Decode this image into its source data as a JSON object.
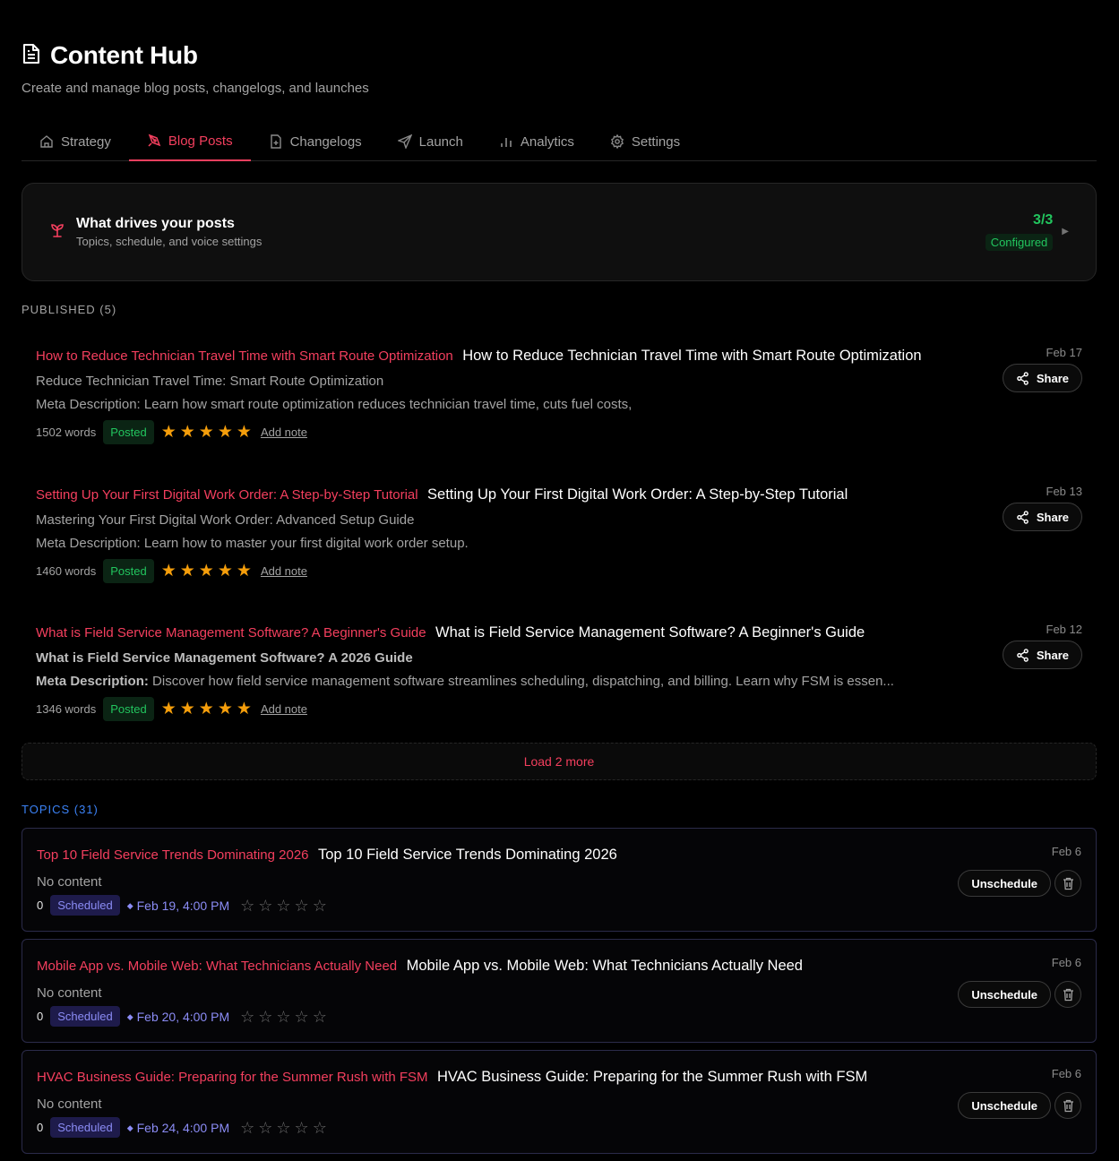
{
  "header": {
    "title": "Content Hub",
    "subtitle": "Create and manage blog posts, changelogs, and launches"
  },
  "tabs": [
    {
      "label": "Strategy",
      "icon": "home-icon",
      "active": false
    },
    {
      "label": "Blog Posts",
      "icon": "pen-icon",
      "active": true
    },
    {
      "label": "Changelogs",
      "icon": "file-plus-icon",
      "active": false
    },
    {
      "label": "Launch",
      "icon": "send-icon",
      "active": false
    },
    {
      "label": "Analytics",
      "icon": "bar-chart-icon",
      "active": false
    },
    {
      "label": "Settings",
      "icon": "gear-icon",
      "active": false
    }
  ],
  "drives": {
    "title": "What drives your posts",
    "subtitle": "Topics, schedule, and voice settings",
    "count": "3/3",
    "status": "Configured"
  },
  "published": {
    "label": "PUBLISHED (5)",
    "posts": [
      {
        "title_pink": "How to Reduce Technician Travel Time with Smart Route Optimization",
        "title_white": "How to Reduce Technician Travel Time with Smart Route Optimization",
        "date": "Feb 17",
        "line2": "Reduce Technician Travel Time: Smart Route Optimization",
        "line3_label": "",
        "line3": "Meta Description: Learn how smart route optimization reduces technician travel time, cuts fuel costs,",
        "words": "1502 words",
        "status": "Posted",
        "rating": 5,
        "note_label": "Add note",
        "share_label": "Share"
      },
      {
        "title_pink": "Setting Up Your First Digital Work Order: A Step-by-Step Tutorial",
        "title_white": "Setting Up Your First Digital Work Order: A Step-by-Step Tutorial",
        "date": "Feb 13",
        "line2": "Mastering Your First Digital Work Order: Advanced Setup Guide",
        "line3_label": "",
        "line3": "Meta Description: Learn how to master your first digital work order setup.",
        "words": "1460 words",
        "status": "Posted",
        "rating": 5,
        "note_label": "Add note",
        "share_label": "Share"
      },
      {
        "title_pink": "What is Field Service Management Software? A Beginner's Guide",
        "title_white": "What is Field Service Management Software? A Beginner's Guide",
        "date": "Feb 12",
        "line2": "What is Field Service Management Software? A 2026 Guide",
        "line3_label": "Meta Description:",
        "line3": " Discover how field service management software streamlines scheduling, dispatching, and billing. Learn why FSM is essen...",
        "words": "1346 words",
        "status": "Posted",
        "rating": 5,
        "note_label": "Add note",
        "share_label": "Share"
      }
    ],
    "load_more": "Load 2 more"
  },
  "topics": {
    "label": "TOPICS (31)",
    "items": [
      {
        "title_pink": "Top 10 Field Service Trends Dominating 2026",
        "title_white": "Top 10 Field Service Trends Dominating 2026",
        "date": "Feb 6",
        "content": "No content",
        "count": "0",
        "status": "Scheduled",
        "scheduled_for": "Feb 19, 4:00 PM",
        "rating": 0,
        "action_label": "Unschedule"
      },
      {
        "title_pink": "Mobile App vs. Mobile Web: What Technicians Actually Need",
        "title_white": "Mobile App vs. Mobile Web: What Technicians Actually Need",
        "date": "Feb 6",
        "content": "No content",
        "count": "0",
        "status": "Scheduled",
        "scheduled_for": "Feb 20, 4:00 PM",
        "rating": 0,
        "action_label": "Unschedule"
      },
      {
        "title_pink": "HVAC Business Guide: Preparing for the Summer Rush with FSM",
        "title_white": "HVAC Business Guide: Preparing for the Summer Rush with FSM",
        "date": "Feb 6",
        "content": "No content",
        "count": "0",
        "status": "Scheduled",
        "scheduled_for": "Feb 24, 4:00 PM",
        "rating": 0,
        "action_label": "Unschedule"
      }
    ]
  },
  "colors": {
    "accent": "#f43f5e",
    "success": "#22c55e",
    "star": "#f59e0b",
    "scheduled": "#8b8cf5",
    "topics_label": "#3b82f6"
  }
}
